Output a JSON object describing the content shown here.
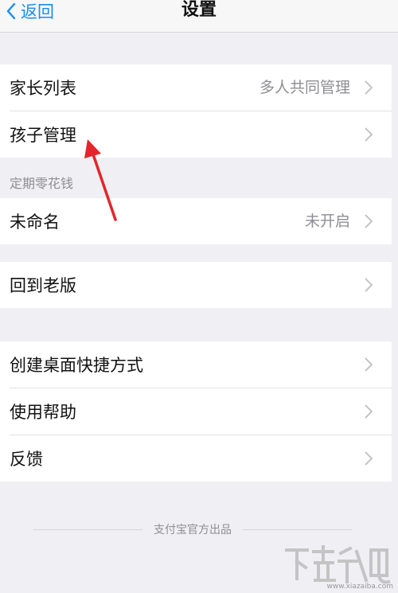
{
  "nav": {
    "back_label": "返回",
    "title": "设置"
  },
  "group1": [
    {
      "label": "家长列表",
      "value": "多人共同管理"
    },
    {
      "label": "孩子管理",
      "value": ""
    }
  ],
  "section_label": "定期零花钱",
  "group2": [
    {
      "label": "未命名",
      "value": "未开启"
    }
  ],
  "group3": [
    {
      "label": "回到老版",
      "value": ""
    }
  ],
  "group4": [
    {
      "label": "创建桌面快捷方式",
      "value": ""
    },
    {
      "label": "使用帮助",
      "value": ""
    },
    {
      "label": "反馈",
      "value": ""
    }
  ],
  "footer": "支付宝官方出品",
  "watermark": {
    "logo": "下载吧",
    "url": "www.xiazaiba.com"
  },
  "colors": {
    "accent": "#1a8cf0",
    "background": "#efeff4",
    "arrow": "#e2262b"
  }
}
